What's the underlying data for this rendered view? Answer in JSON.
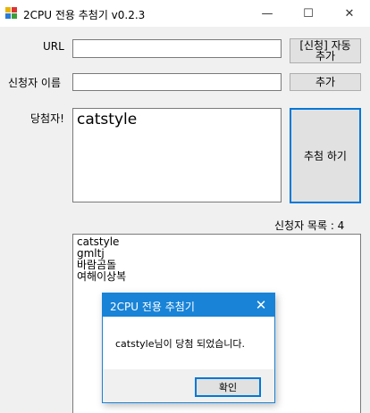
{
  "window": {
    "title": "2CPU 전용 추첨기 v0.2.3",
    "minimize_glyph": "—",
    "maximize_glyph": "☐",
    "close_glyph": "✕"
  },
  "form": {
    "url_label": "URL",
    "url_value": "",
    "auto_add_button_line1": "[신청] 자동",
    "auto_add_button_line2": "추가",
    "applicant_label": "신청자 이름",
    "applicant_value": "",
    "add_button": "추가",
    "winner_label": "당첨자!",
    "winner_value": "catstyle",
    "draw_button": "추첨 하기",
    "list_count_label": "신청자 목록 : 4"
  },
  "applicants": [
    "catstyle",
    "gmltj",
    "바람곰돌",
    "여해이상복"
  ],
  "dialog": {
    "title": "2CPU 전용 추첨기",
    "message": "catstyle님이 당첨 되었습니다.",
    "ok_button": "확인",
    "close_glyph": "✕"
  },
  "colors": {
    "accent": "#0078d7",
    "dialog_title_bg": "#1883d7",
    "window_bg": "#f0f0f0"
  }
}
